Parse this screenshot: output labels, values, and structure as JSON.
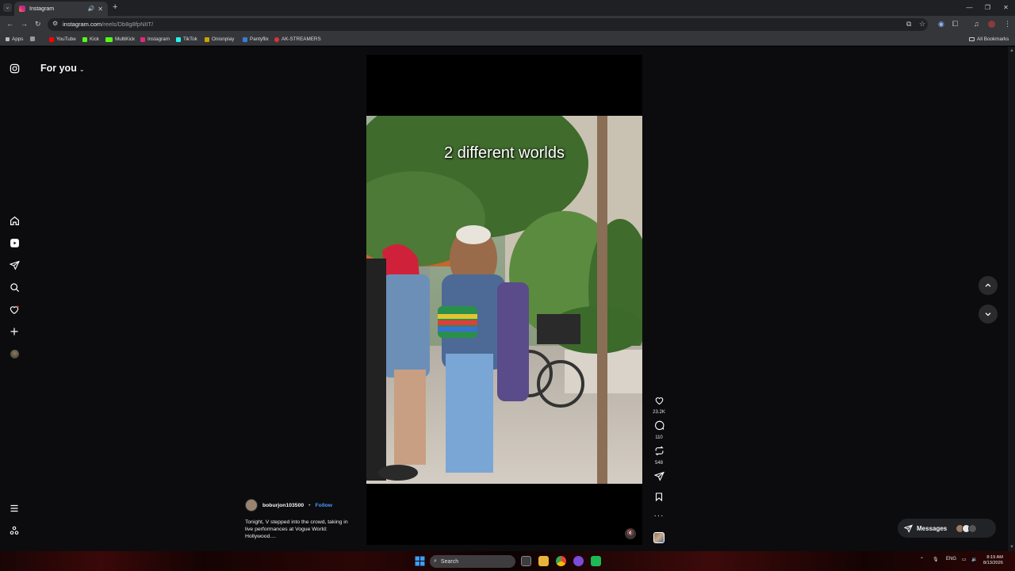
{
  "browser": {
    "tab_title": "Instagram",
    "url_host": "instagram.com",
    "url_path": "/reels/Db8g8fpNIIT/",
    "new_tab": "+",
    "bookmarks": [
      "Apps",
      "YouTube",
      "Kick",
      "MultiKick",
      "Instagram",
      "TikTok",
      "Onionplay",
      "Pantyflix",
      "AK-STREAMERS"
    ],
    "all_bookmarks": "All Bookmarks"
  },
  "header": {
    "feed_label": "For you"
  },
  "reel": {
    "overlay_text": "2 different worlds",
    "likes": "23.2K",
    "comments": "110",
    "reposts": "548",
    "author": "boburjon103500",
    "separator": "•",
    "follow": "Follow",
    "caption": "Tonight, V stepped into the crowd, taking in live performances at Vogue World: Hollywood...."
  },
  "messages": {
    "label": "Messages"
  },
  "taskbar": {
    "search_placeholder": "Search",
    "language": "ENG",
    "time": "8:19 AM",
    "date": "8/13/2026"
  },
  "colors": {
    "follow": "#4a9bff",
    "page_bg": "#0c0c0e",
    "chrome_bg": "#35363a"
  },
  "icons": {
    "sidebar": [
      "instagram-icon",
      "home-icon",
      "reels-icon",
      "send-icon",
      "search-icon",
      "heart-icon",
      "plus-icon",
      "profile-avatar",
      "menu-icon",
      "threads-icon"
    ],
    "actions": [
      "heart-icon",
      "comment-icon",
      "repost-icon",
      "send-icon",
      "bookmark-icon",
      "more-icon",
      "audio-thumbnail"
    ]
  }
}
